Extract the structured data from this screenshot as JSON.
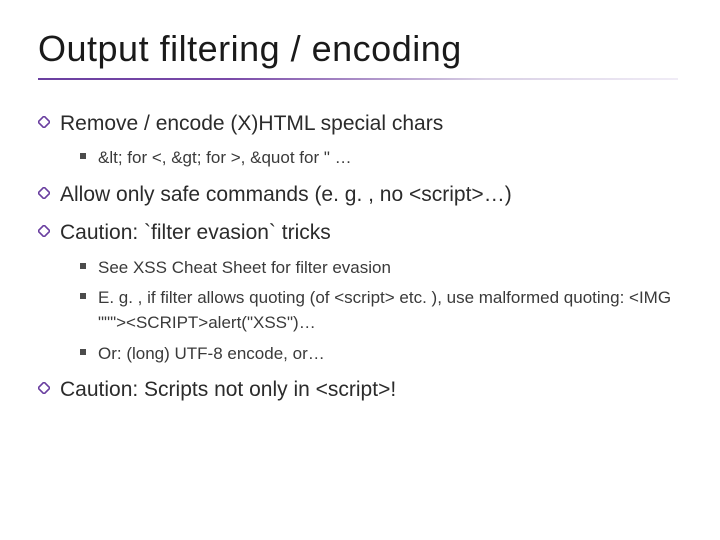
{
  "title": "Output filtering / encoding",
  "bullets": {
    "b1": "Remove / encode (X)HTML special chars",
    "b1_1": "&lt; for <, &gt; for >, &quot for \" …",
    "b2": "Allow only safe commands (e. g. , no <script>…)",
    "b3": "Caution: `filter evasion` tricks",
    "b3_1": "See XSS Cheat Sheet for filter evasion",
    "b3_2": "E. g. , if filter allows quoting (of <script> etc. ), use malformed quoting: <IMG \"\"\"><SCRIPT>alert(\"XSS\")…",
    "b3_3": "Or: (long) UTF-8 encode, or…",
    "b4": "Caution: Scripts not only in <script>!"
  },
  "colors": {
    "accent": "#6a3fa0"
  }
}
